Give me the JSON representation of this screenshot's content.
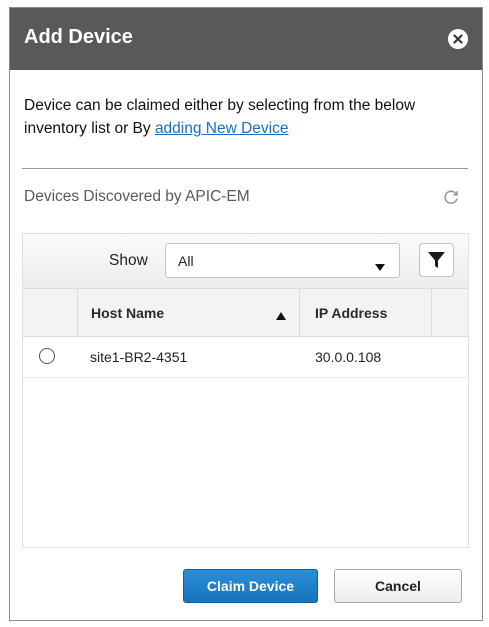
{
  "dialog": {
    "title": "Add Device",
    "intro_text": "Device can be claimed either by selecting from the below inventory list or By ",
    "intro_link": "adding New Device",
    "section_title": "Devices Discovered by APIC-EM",
    "icons": {
      "close": "close-icon",
      "refresh": "refresh-icon",
      "filter": "filter-icon",
      "dropdown": "chevron-down-icon",
      "sort": "sort-ascending-icon"
    }
  },
  "grid": {
    "show_label": "Show",
    "show_value": "All",
    "columns": {
      "host": "Host Name",
      "ip": "IP Address"
    },
    "rows": [
      {
        "host": "site1-BR2-4351",
        "ip": "30.0.0.108",
        "selected": false
      }
    ]
  },
  "footer": {
    "claim_label": "Claim Device",
    "cancel_label": "Cancel"
  },
  "colors": {
    "header_bg": "#595959",
    "primary": "#1a7ac6",
    "link": "#1a6fc2"
  }
}
